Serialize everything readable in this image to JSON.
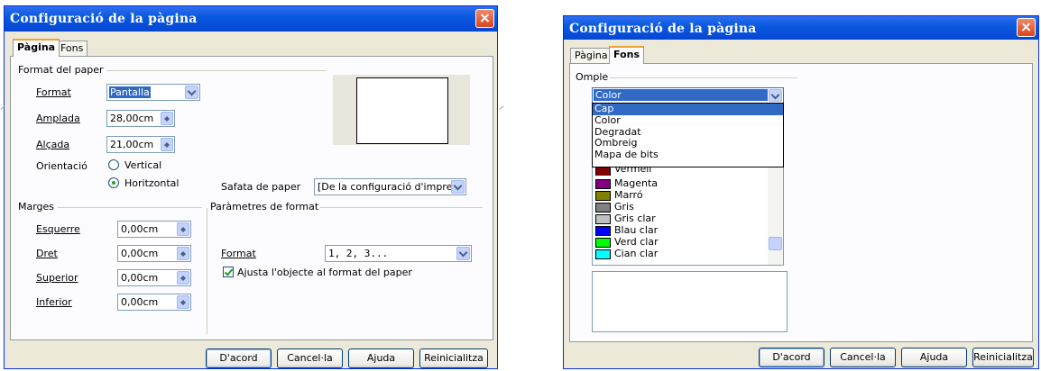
{
  "left_dialog": {
    "title": "Configuració de la pàgina",
    "tabs": [
      "Pàgina",
      "Fons"
    ],
    "paper_section": "Format del paper",
    "format_label": "Format",
    "format_value": "Pantalla",
    "width_label": "Amplada",
    "width_value": "28,00cm",
    "height_label": "Alçada",
    "height_value": "21,00cm",
    "orientation_label": "Orientació",
    "orientation_vertical": "Vertical",
    "orientation_horizontal": "Horitzontal",
    "orientation_selected": "Horitzontal",
    "tray_label": "Safata de paper",
    "tray_value": "[De la configuració d'impresso",
    "margins_section": "Marges",
    "margins": [
      {
        "label": "Esquerre",
        "value": "0,00cm"
      },
      {
        "label": "Dret",
        "value": "0,00cm"
      },
      {
        "label": "Superior",
        "value": "0,00cm"
      },
      {
        "label": "Inferior",
        "value": "0,00cm"
      }
    ],
    "layout_section": "Paràmetres de format",
    "layout_format_label": "Format",
    "layout_format_value": "1, 2, 3...",
    "fit_checkbox_label": "Ajusta l'objecte al format del paper",
    "fit_checked": true,
    "buttons": [
      "D'acord",
      "Cancel·la",
      "Ajuda",
      "Reinicialitza"
    ]
  },
  "right_dialog": {
    "title": "Configuració de la pàgina",
    "tabs": [
      "Pàgina",
      "Fons"
    ],
    "fill_section": "Omple",
    "fill_value": "Color",
    "fill_options": [
      "Cap",
      "Color",
      "Degradat",
      "Ombreig",
      "Mapa de bits"
    ],
    "fill_highlighted": "Cap",
    "color_list": [
      {
        "name": "Vermell",
        "color": "#800000"
      },
      {
        "name": "Magenta",
        "color": "#800080"
      },
      {
        "name": "Marró",
        "color": "#808000"
      },
      {
        "name": "Gris",
        "color": "#808080"
      },
      {
        "name": "Gris clar",
        "color": "#c0c0c0"
      },
      {
        "name": "Blau clar",
        "color": "#0000ff"
      },
      {
        "name": "Verd clar",
        "color": "#00ff00"
      },
      {
        "name": "Cian clar",
        "color": "#00ffff"
      }
    ],
    "buttons": [
      "D'acord",
      "Cancel·la",
      "Ajuda",
      "Reinicialitza"
    ]
  }
}
